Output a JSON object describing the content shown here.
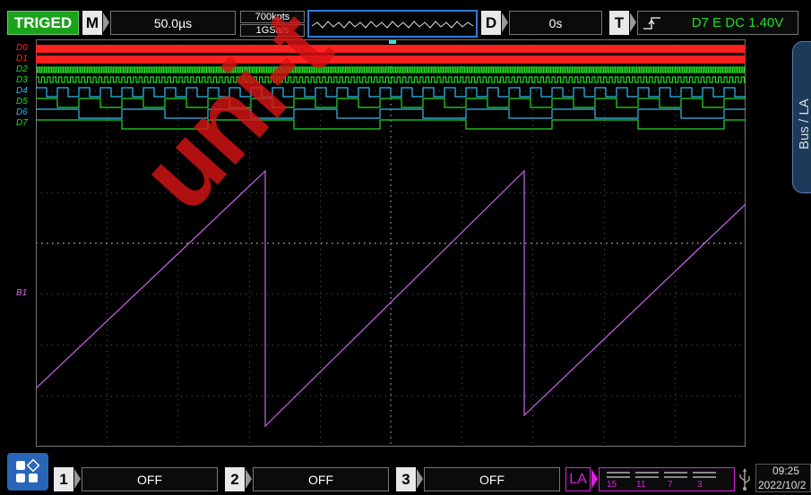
{
  "top_bar": {
    "status": "TRIGED",
    "timebase_tag": "M",
    "timebase": "50.0µs",
    "memory_depth": "700kpts",
    "sample_rate": "1GSa/s",
    "delay_tag": "D",
    "delay": "0s",
    "trigger_tag": "T",
    "trigger_info": "D7 E DC 1.40V"
  },
  "side_panel": {
    "label": "Bus / LA"
  },
  "channels": {
    "digital": [
      {
        "label": "D0",
        "color": "#ff2020"
      },
      {
        "label": "D1",
        "color": "#ff2020"
      },
      {
        "label": "D2",
        "color": "#22dd22"
      },
      {
        "label": "D3",
        "color": "#22dd22"
      },
      {
        "label": "D4",
        "color": "#33bbee"
      },
      {
        "label": "D5",
        "color": "#22dd22"
      },
      {
        "label": "D6",
        "color": "#33bbee"
      },
      {
        "label": "D7",
        "color": "#22dd22"
      }
    ],
    "bus": {
      "label": "B1",
      "color": "#cc66ee"
    }
  },
  "watermark": "uni-t",
  "bottom_bar": {
    "ch1": {
      "num": "1",
      "value": "OFF"
    },
    "ch2": {
      "num": "2",
      "value": "OFF"
    },
    "ch3": {
      "num": "3",
      "value": "OFF"
    },
    "la": {
      "tag": "LA",
      "groups": [
        "15",
        "11",
        "7",
        "3"
      ]
    },
    "time": "09:25",
    "date": "2022/10/2"
  },
  "colors": {
    "triged": "#1aa31a",
    "la_accent": "#dd22dd",
    "highlight": "#2a7fd8"
  }
}
